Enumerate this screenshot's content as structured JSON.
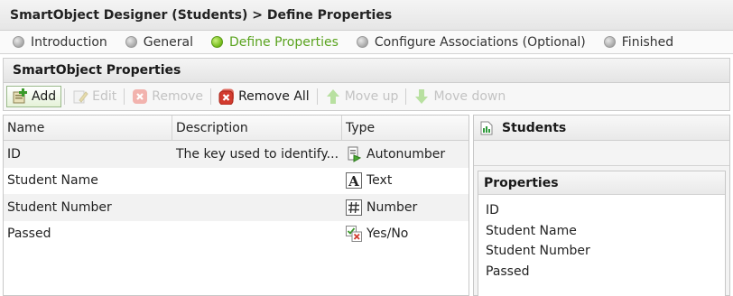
{
  "window": {
    "title": "SmartObject Designer (Students) > Define Properties"
  },
  "steps": [
    {
      "label": "Introduction",
      "active": false
    },
    {
      "label": "General",
      "active": false
    },
    {
      "label": "Define Properties",
      "active": true
    },
    {
      "label": "Configure Associations (Optional)",
      "active": false
    },
    {
      "label": "Finished",
      "active": false
    }
  ],
  "panel": {
    "title": "SmartObject Properties"
  },
  "toolbar": {
    "add": "Add",
    "edit": "Edit",
    "remove": "Remove",
    "remove_all": "Remove All",
    "move_up": "Move up",
    "move_down": "Move down"
  },
  "grid": {
    "columns": {
      "name": "Name",
      "description": "Description",
      "type": "Type"
    },
    "rows": [
      {
        "name": "ID",
        "description": "The key used to identify...",
        "type": "Autonumber",
        "type_icon": "autonumber-icon"
      },
      {
        "name": "Student Name",
        "description": "",
        "type": "Text",
        "type_icon": "text-type-icon"
      },
      {
        "name": "Student Number",
        "description": "",
        "type": "Number",
        "type_icon": "number-type-icon"
      },
      {
        "name": "Passed",
        "description": "",
        "type": "Yes/No",
        "type_icon": "yes-no-type-icon"
      }
    ]
  },
  "side": {
    "title": "Students",
    "properties_title": "Properties",
    "properties": [
      "ID",
      "Student Name",
      "Student Number",
      "Passed"
    ]
  },
  "colors": {
    "active_step": "#5aa31f",
    "disabled_text": "#c3c3c3"
  }
}
